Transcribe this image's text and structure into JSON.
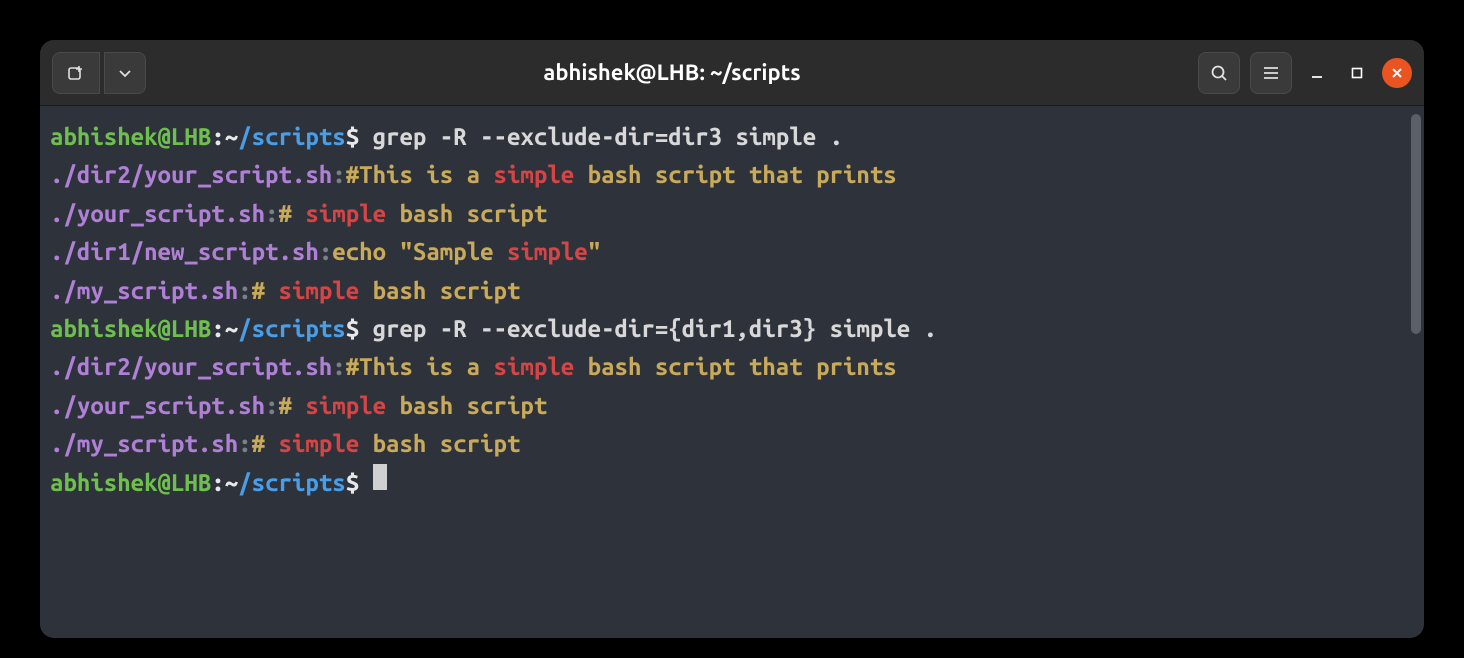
{
  "window": {
    "title": "abhishek@LHB: ~/scripts"
  },
  "prompt": {
    "user_host": "abhishek@LHB",
    "sep1": ":",
    "path_prefix": "~",
    "path": "/scripts",
    "sigil": "$ "
  },
  "commands": {
    "cmd1": "grep -R --exclude-dir=dir3 simple .",
    "cmd2": "grep -R --exclude-dir={dir1,dir3} simple .",
    "cmd3": ""
  },
  "output": {
    "block1": [
      {
        "file": "./dir2/your_script.sh",
        "colon": ":",
        "pre": "#This is a ",
        "match": "simple",
        "post": " bash script that prints"
      },
      {
        "file": "./your_script.sh",
        "colon": ":",
        "pre": "# ",
        "match": "simple",
        "post": " bash script"
      },
      {
        "file": "./dir1/new_script.sh",
        "colon": ":",
        "pre": "echo \"Sample ",
        "match": "simple",
        "post": "\""
      },
      {
        "file": "./my_script.sh",
        "colon": ":",
        "pre": "# ",
        "match": "simple",
        "post": " bash script"
      }
    ],
    "block2": [
      {
        "file": "./dir2/your_script.sh",
        "colon": ":",
        "pre": "#This is a ",
        "match": "simple",
        "post": " bash script that prints"
      },
      {
        "file": "./your_script.sh",
        "colon": ":",
        "pre": "# ",
        "match": "simple",
        "post": " bash script"
      },
      {
        "file": "./my_script.sh",
        "colon": ":",
        "pre": "# ",
        "match": "simple",
        "post": " bash script"
      }
    ]
  }
}
